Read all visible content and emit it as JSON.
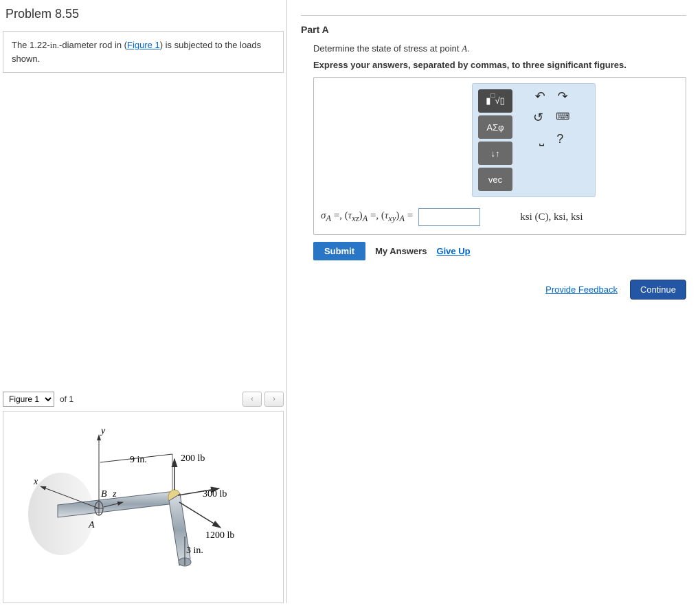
{
  "problem": {
    "title": "Problem 8.55",
    "statement_pre": "The 1.22-",
    "statement_unit": "in.",
    "statement_mid": "-diameter rod in (",
    "figure_link": "Figure 1",
    "statement_post": ") is subjected to the loads shown."
  },
  "figure": {
    "selector_label": "Figure 1",
    "of_label": "of 1",
    "prev": "‹",
    "next": "›",
    "labels": {
      "x": "x",
      "y": "y",
      "z": "z",
      "A": "A",
      "B": "B",
      "dim1": "9 in.",
      "dim2": "3 in.",
      "load1": "200 lb",
      "load2": "300 lb",
      "load3": "1200 lb"
    }
  },
  "partA": {
    "title": "Part A",
    "desc": "Determine the state of stress at point A.",
    "instr": "Express your answers, separated by commas, to three significant figures.",
    "toolbar": {
      "btn1": "√",
      "btn2": "ΑΣφ",
      "btn3": "↓↑",
      "btn4": "vec",
      "undo": "↶",
      "redo": "↷",
      "reset": "↺",
      "keyboard": "⌨",
      "more": "⎵",
      "help": "?"
    },
    "equation": "σA =, (τxz)A =, (τxy)A =",
    "units": "ksi (C), ksi, ksi",
    "submit": "Submit",
    "my_answers": "My Answers",
    "give_up": "Give Up"
  },
  "bottom": {
    "feedback": "Provide Feedback",
    "continue": "Continue"
  }
}
